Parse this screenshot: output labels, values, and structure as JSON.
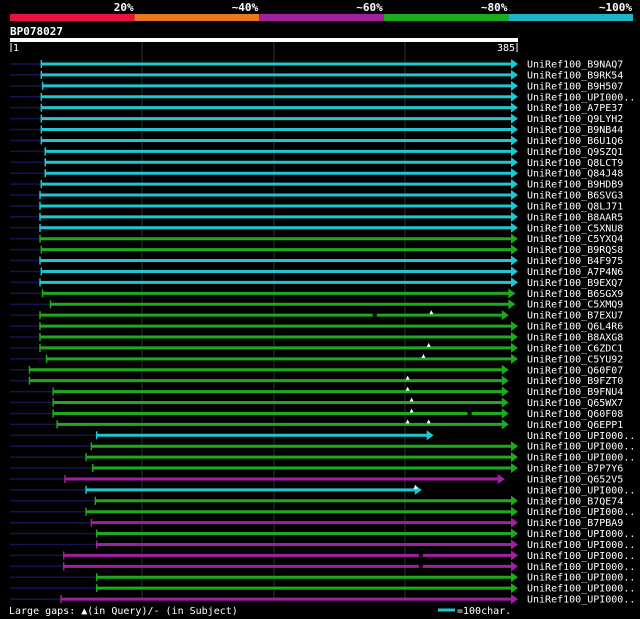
{
  "legend": {
    "labels": [
      "20%",
      "~40%",
      "~60%",
      "~80%",
      "~100%"
    ],
    "colors": [
      "#e8143c",
      "#e8781e",
      "#a020a0",
      "#1eaa1e",
      "#1eb4c8"
    ]
  },
  "query": {
    "name": "BP078027",
    "start_label": "1",
    "end_label": "385"
  },
  "hits": [
    {
      "name": "UniRef100_B9NAQ7",
      "start": 24,
      "end": 385,
      "color": "cyan",
      "pre_line": true
    },
    {
      "name": "UniRef100_B9RK54",
      "start": 24,
      "end": 385,
      "color": "cyan",
      "pre_line": true
    },
    {
      "name": "UniRef100_B9H507",
      "start": 25,
      "end": 385,
      "color": "cyan",
      "pre_line": true
    },
    {
      "name": "UniRef100_UPI000..",
      "start": 24,
      "end": 385,
      "color": "cyan",
      "pre_line": true
    },
    {
      "name": "UniRef100_A7PE37",
      "start": 24,
      "end": 385,
      "color": "cyan",
      "pre_line": true
    },
    {
      "name": "UniRef100_Q9LYH2",
      "start": 24,
      "end": 385,
      "color": "cyan",
      "pre_line": true
    },
    {
      "name": "UniRef100_B9NB44",
      "start": 24,
      "end": 385,
      "color": "cyan",
      "pre_line": true
    },
    {
      "name": "UniRef100_B6U1Q6",
      "start": 24,
      "end": 385,
      "color": "cyan",
      "pre_line": true
    },
    {
      "name": "UniRef100_Q9SZQ1",
      "start": 27,
      "end": 385,
      "color": "cyan",
      "pre_line": true
    },
    {
      "name": "UniRef100_Q8LCT9",
      "start": 27,
      "end": 385,
      "color": "cyan",
      "pre_line": true
    },
    {
      "name": "UniRef100_Q84J48",
      "start": 27,
      "end": 385,
      "color": "cyan",
      "pre_line": true
    },
    {
      "name": "UniRef100_B9HDB9",
      "start": 24,
      "end": 385,
      "color": "cyan",
      "pre_line": true
    },
    {
      "name": "UniRef100_B6SVG3",
      "start": 23,
      "end": 385,
      "color": "cyan",
      "pre_line": true
    },
    {
      "name": "UniRef100_Q8LJ71",
      "start": 23,
      "end": 385,
      "color": "cyan",
      "pre_line": true
    },
    {
      "name": "UniRef100_B8AAR5",
      "start": 23,
      "end": 385,
      "color": "cyan",
      "pre_line": true
    },
    {
      "name": "UniRef100_C5XNU8",
      "start": 23,
      "end": 385,
      "color": "cyan",
      "pre_line": true
    },
    {
      "name": "UniRef100_C5YXQ4",
      "start": 23,
      "end": 385,
      "color": "green",
      "pre_line": true
    },
    {
      "name": "UniRef100_B9RQS8",
      "start": 24,
      "end": 385,
      "color": "green",
      "pre_line": true
    },
    {
      "name": "UniRef100_B4F975",
      "start": 23,
      "end": 385,
      "color": "cyan",
      "pre_line": true
    },
    {
      "name": "UniRef100_A7P4N6",
      "start": 24,
      "end": 385,
      "color": "cyan",
      "pre_line": true
    },
    {
      "name": "UniRef100_B9EXQ7",
      "start": 23,
      "end": 385,
      "color": "cyan",
      "pre_line": true
    },
    {
      "name": "UniRef100_B6SGX9",
      "start": 25,
      "end": 383,
      "color": "green",
      "pre_line": true
    },
    {
      "name": "UniRef100_C5XMQ9",
      "start": 31,
      "end": 383,
      "color": "green",
      "pre_line": true
    },
    {
      "name": "UniRef100_B7EXU7",
      "start": 23,
      "end": 378,
      "color": "green",
      "pre_line": true,
      "marks": [
        {
          "pos": 277,
          "type": "dash"
        },
        {
          "pos": 320,
          "type": "tri"
        }
      ]
    },
    {
      "name": "UniRef100_Q6L4R6",
      "start": 23,
      "end": 385,
      "color": "green",
      "pre_line": true
    },
    {
      "name": "UniRef100_B8AXG8",
      "start": 23,
      "end": 385,
      "color": "green",
      "pre_line": true
    },
    {
      "name": "UniRef100_C6ZDC1",
      "start": 23,
      "end": 385,
      "color": "green",
      "pre_line": true,
      "marks": [
        {
          "pos": 318,
          "type": "tri"
        }
      ]
    },
    {
      "name": "UniRef100_C5YU92",
      "start": 28,
      "end": 385,
      "color": "green",
      "pre_line": true,
      "marks": [
        {
          "pos": 314,
          "type": "tri"
        }
      ]
    },
    {
      "name": "UniRef100_Q60F07",
      "start": 15,
      "end": 378,
      "color": "green",
      "pre_line": true
    },
    {
      "name": "UniRef100_B9FZT0",
      "start": 15,
      "end": 378,
      "color": "green",
      "pre_line": true,
      "marks": [
        {
          "pos": 302,
          "type": "tri"
        }
      ]
    },
    {
      "name": "UniRef100_B9FNU4",
      "start": 33,
      "end": 378,
      "color": "green",
      "pre_line": true,
      "marks": [
        {
          "pos": 302,
          "type": "tri"
        }
      ]
    },
    {
      "name": "UniRef100_Q65WX7",
      "start": 33,
      "end": 378,
      "color": "green",
      "pre_line": true,
      "marks": [
        {
          "pos": 305,
          "type": "tri"
        }
      ]
    },
    {
      "name": "UniRef100_Q60F08",
      "start": 33,
      "end": 378,
      "color": "green",
      "pre_line": true,
      "marks": [
        {
          "pos": 305,
          "type": "tri"
        },
        {
          "pos": 349,
          "type": "dash"
        }
      ]
    },
    {
      "name": "UniRef100_Q6EPP1",
      "start": 36,
      "end": 378,
      "color": "green",
      "pre_line": true,
      "marks": [
        {
          "pos": 302,
          "type": "tri"
        },
        {
          "pos": 318,
          "type": "tri"
        }
      ]
    },
    {
      "name": "UniRef100_UPI000..",
      "start": 66,
      "end": 321,
      "color": "cyan",
      "pre_line": true
    },
    {
      "name": "UniRef100_UPI000..",
      "start": 62,
      "end": 385,
      "color": "green",
      "pre_line": true
    },
    {
      "name": "UniRef100_UPI000..",
      "start": 58,
      "end": 385,
      "color": "green",
      "pre_line": true
    },
    {
      "name": "UniRef100_B7P7Y6",
      "start": 63,
      "end": 385,
      "color": "green",
      "pre_line": true
    },
    {
      "name": "UniRef100_Q652V5",
      "start": 42,
      "end": 375,
      "color": "magenta",
      "pre_line": true
    },
    {
      "name": "UniRef100_UPI000..",
      "start": 58,
      "end": 312,
      "color": "cyan",
      "pre_line": true,
      "marks": [
        {
          "pos": 308,
          "type": "tri"
        }
      ]
    },
    {
      "name": "UniRef100_B7QE74",
      "start": 65,
      "end": 385,
      "color": "green",
      "pre_line": true
    },
    {
      "name": "UniRef100_UPI000..",
      "start": 58,
      "end": 385,
      "color": "green",
      "pre_line": true
    },
    {
      "name": "UniRef100_B7PBA9",
      "start": 62,
      "end": 385,
      "color": "magenta",
      "pre_line": true
    },
    {
      "name": "UniRef100_UPI000..",
      "start": 66,
      "end": 385,
      "color": "green",
      "pre_line": true
    },
    {
      "name": "UniRef100_UPI000..",
      "start": 66,
      "end": 385,
      "color": "magenta",
      "pre_line": true
    },
    {
      "name": "UniRef100_UPI000..",
      "start": 41,
      "end": 385,
      "color": "magenta",
      "pre_line": true,
      "marks": [
        {
          "pos": 312,
          "type": "dash"
        }
      ]
    },
    {
      "name": "UniRef100_UPI000..",
      "start": 41,
      "end": 385,
      "color": "magenta",
      "pre_line": true,
      "marks": [
        {
          "pos": 312,
          "type": "dash"
        }
      ]
    },
    {
      "name": "UniRef100_UPI000..",
      "start": 66,
      "end": 385,
      "color": "green",
      "pre_line": true
    },
    {
      "name": "UniRef100_UPI000..",
      "start": 66,
      "end": 385,
      "color": "green",
      "pre_line": true
    },
    {
      "name": "UniRef100_UPI000..",
      "start": 39,
      "end": 385,
      "color": "magenta",
      "pre_line": true
    }
  ],
  "footer": {
    "gaps_text": "Large gaps: ▲(in Query)/- (in Subject)",
    "scale_text": "=100char."
  },
  "colors": {
    "cyan": "#1ec8d2",
    "green": "#1eaa1e",
    "magenta": "#a020a0",
    "preline": "#141450",
    "grid": "#1e3c1e"
  }
}
